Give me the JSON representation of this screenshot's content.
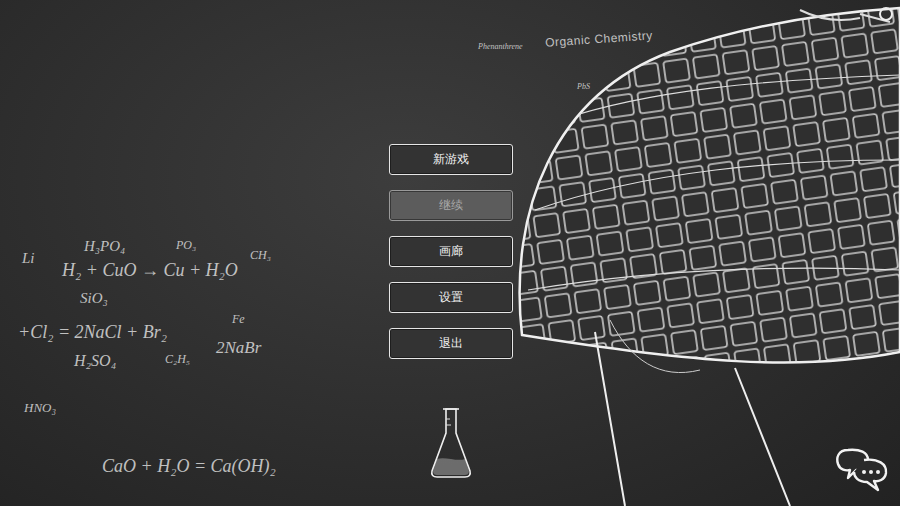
{
  "menu": {
    "buttons": [
      {
        "label": "新游戏",
        "disabled": false
      },
      {
        "label": "继续",
        "disabled": true
      },
      {
        "label": "画廊",
        "disabled": false
      },
      {
        "label": "设置",
        "disabled": false
      },
      {
        "label": "退出",
        "disabled": false
      }
    ]
  },
  "chalkboard": {
    "title": "Organic Chemistry",
    "labels": [
      "Phenanthrene",
      "PbS"
    ],
    "formulas": [
      "Li",
      "H₃PO₄",
      "PO₃",
      "H₂ + CuO → Cu + H₂O",
      "CH₃",
      "SiO₃",
      "+Cl₂ = 2NaCl + Br₂",
      "Fe",
      "2NaBr",
      "H₂SO₄",
      "C₂H₅",
      "HNO₃",
      "CaO + H₂O = Ca(OH)₂"
    ]
  }
}
